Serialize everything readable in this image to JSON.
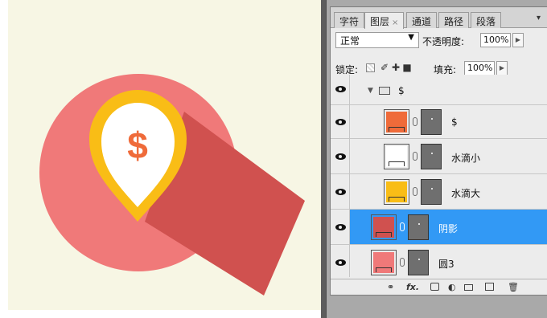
{
  "panel": {
    "tabs": [
      {
        "label": "字符",
        "close": ""
      },
      {
        "label": "图层",
        "close": "×"
      },
      {
        "label": "通道",
        "close": ""
      },
      {
        "label": "路径",
        "close": ""
      },
      {
        "label": "段落",
        "close": ""
      }
    ],
    "blend_mode": "正常",
    "opacity_label": "不透明度:",
    "opacity_value": "100%",
    "lock_label": "锁定:",
    "fill_label": "填充:",
    "fill_value": "100%"
  },
  "layers": [
    {
      "name": "$",
      "type": "group",
      "visible": true
    },
    {
      "name": "$",
      "type": "shape",
      "color": "#ef6b3a",
      "visible": true,
      "selected": false
    },
    {
      "name": "水滴小",
      "type": "shape",
      "color": "#ffffff",
      "visible": true,
      "selected": false
    },
    {
      "name": "水滴大",
      "type": "shape",
      "color": "#f9bd16",
      "visible": true,
      "selected": false
    },
    {
      "name": "阴影",
      "type": "shape",
      "color": "#d0514f",
      "visible": true,
      "selected": true
    },
    {
      "name": "圆3",
      "type": "shape",
      "color": "#f07979",
      "visible": true,
      "selected": false
    }
  ],
  "artwork": {
    "background": "#f7f6e4",
    "circle_color": "#f07979",
    "shadow_color": "#d0514f",
    "pin_outer_color": "#f9bd16",
    "pin_inner_color": "#ffffff",
    "symbol_color": "#ef6b3a",
    "symbol": "$"
  },
  "bottom_bar_icons": [
    "link-icon",
    "fx-icon",
    "mask-icon",
    "adjustment-icon",
    "folder-icon",
    "new-layer-icon",
    "trash-icon"
  ],
  "fx_label": "fx."
}
